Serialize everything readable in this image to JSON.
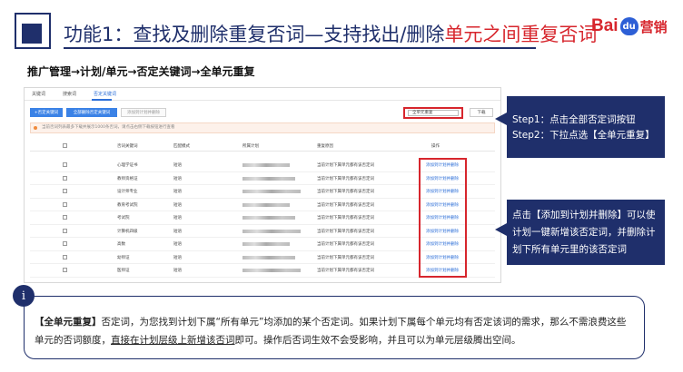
{
  "header": {
    "title_prefix": "功能1：查找及删除重复否词—支持找出/删除",
    "title_highlight": "单元之间重复否词",
    "logo_bai": "Bai",
    "logo_du": "du",
    "logo_yingxiao": "营销"
  },
  "subheading": "推广管理→计划/单元→否定关键词→全单元重复",
  "panel": {
    "tabs": [
      "关键词",
      "搜索词",
      "否定关键词"
    ],
    "buttons": [
      "+否定关键词",
      "全部删除否定关键词",
      "添加到计划并删除"
    ],
    "filter_value": "全单元重复",
    "download_label": "下载",
    "notice": "当前否词列表最多下载并展示1000条否词，请点击右侧下载按钮进行查看",
    "columns": [
      "否词关键词",
      "匹配模式",
      "所属计划",
      "重复原因",
      "操作"
    ],
    "rows": [
      {
        "keyword": "心理学证书",
        "match": "短语",
        "reason": "当前计划下属单元都有该否定词",
        "action": "添加到计划并删除"
      },
      {
        "keyword": "教师资格证",
        "match": "短语",
        "reason": "当前计划下属单元都有该否定词",
        "action": "添加到计划并删除"
      },
      {
        "keyword": "设计师专业",
        "match": "短语",
        "reason": "当前计划下属单元都有该否定词",
        "action": "添加到计划并删除"
      },
      {
        "keyword": "教育考试院",
        "match": "短语",
        "reason": "当前计划下属单元都有该否定词",
        "action": "添加到计划并删除"
      },
      {
        "keyword": "考试院",
        "match": "短语",
        "reason": "当前计划下属单元都有该否定词",
        "action": "添加到计划并删除"
      },
      {
        "keyword": "计算机四级",
        "match": "短语",
        "reason": "当前计划下属单元都有该否定词",
        "action": "添加到计划并删除"
      },
      {
        "keyword": "高数",
        "match": "短语",
        "reason": "当前计划下属单元都有该否定词",
        "action": "添加到计划并删除"
      },
      {
        "keyword": "幼师证",
        "match": "短语",
        "reason": "当前计划下属单元都有该否定词",
        "action": "添加到计划并删除"
      },
      {
        "keyword": "医师证",
        "match": "短语",
        "reason": "当前计划下属单元都有该否定词",
        "action": "添加到计划并删除"
      }
    ]
  },
  "steps": {
    "step1": "Step1：点击全部否定词按钮",
    "step2": "Step2：下拉点选【全单元重复】"
  },
  "desc": "点击【添加到计划并删除】可以使计划一键新增该否定词，并删除计划下所有单元里的该否定词",
  "info": {
    "icon": "i",
    "lead": "【全单元重复】",
    "part1": "否定词，为您找到计划下属“所有单元”均添加的某个否定词。如果计划下属每个单元均有否定该词的需求，那么不需浪费这些单元的否词额度，",
    "underlined": "直接在计划层级上新增该否词",
    "part2": "即可。操作后否词生效不会受影响，并且可以为单元层级腾出空间。"
  }
}
